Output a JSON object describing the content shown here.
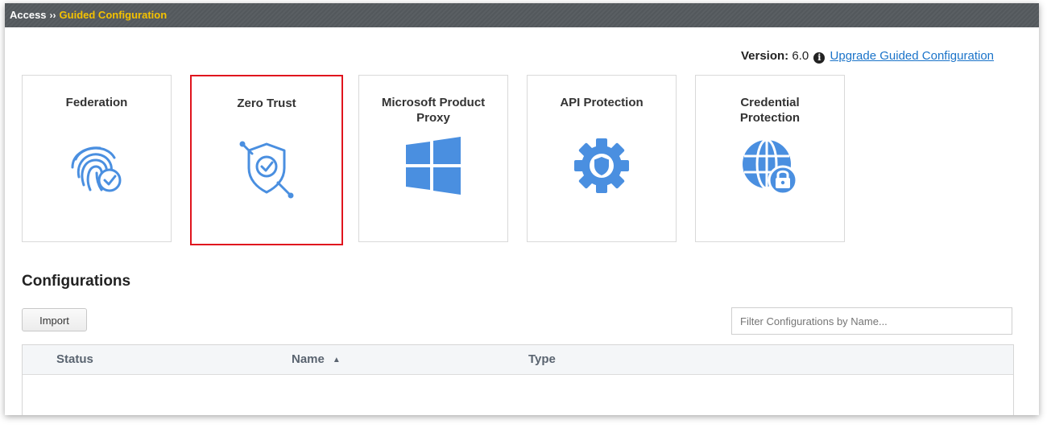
{
  "breadcrumb": {
    "root": "Access",
    "separator": "››",
    "current": "Guided Configuration"
  },
  "version": {
    "label": "Version:",
    "value": "6.0",
    "link": "Upgrade Guided Configuration"
  },
  "tiles": [
    {
      "title": "Federation",
      "icon": "fingerprint-check-icon"
    },
    {
      "title": "Zero Trust",
      "icon": "shield-check-icon",
      "selected": true
    },
    {
      "title": "Microsoft Product Proxy",
      "icon": "windows-logo-icon"
    },
    {
      "title": "API Protection",
      "icon": "gear-shield-icon"
    },
    {
      "title": "Credential Protection",
      "icon": "globe-lock-icon"
    }
  ],
  "configurations": {
    "heading": "Configurations",
    "import_label": "Import",
    "filter_placeholder": "Filter Configurations by Name...",
    "columns": [
      "Status",
      "Name",
      "Type"
    ],
    "sort_indicator": "▲"
  },
  "colors": {
    "accent": "#4a8fe0",
    "breadcrumb_current": "#f5c200",
    "selected_border": "#e0141e",
    "link": "#1a73c9"
  }
}
